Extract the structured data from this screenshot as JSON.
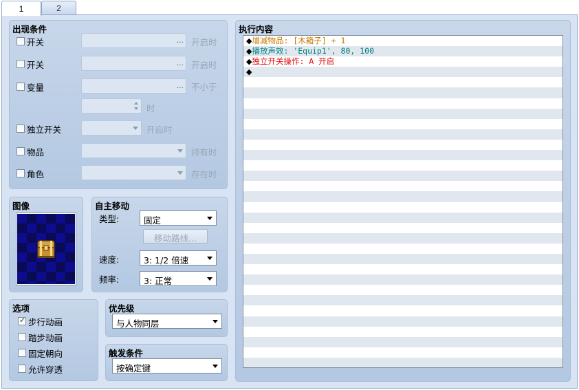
{
  "tabs": [
    {
      "label": "1"
    },
    {
      "label": "2"
    }
  ],
  "conditions": {
    "title": "出现条件",
    "switch1": {
      "label": "开关",
      "suffix": "开启时"
    },
    "switch2": {
      "label": "开关",
      "suffix": "开启时"
    },
    "variable": {
      "label": "变量",
      "suffix": "不小于",
      "suffix2": "时"
    },
    "self_switch": {
      "label": "独立开关",
      "suffix": "开启时"
    },
    "item": {
      "label": "物品",
      "suffix": "持有时"
    },
    "actor": {
      "label": "角色",
      "suffix": "存在时"
    },
    "dots": "..."
  },
  "image": {
    "title": "图像"
  },
  "autonomous": {
    "title": "自主移动",
    "type_label": "类型:",
    "type_value": "固定",
    "route_button": "移动路线...",
    "speed_label": "速度:",
    "speed_value": "3: 1/2 倍速",
    "freq_label": "频率:",
    "freq_value": "3: 正常"
  },
  "options": {
    "title": "选项",
    "items": [
      {
        "label": "步行动画",
        "checked": true
      },
      {
        "label": "踏步动画",
        "checked": false
      },
      {
        "label": "固定朝向",
        "checked": false
      },
      {
        "label": "允许穿透",
        "checked": false
      }
    ],
    "checkmark": "✓"
  },
  "priority": {
    "title": "优先级",
    "value": "与人物同层"
  },
  "trigger": {
    "title": "触发条件",
    "value": "按确定键"
  },
  "contents": {
    "title": "执行内容",
    "bullet": "◆",
    "commands": [
      {
        "text": "增减物品: [木箱子] + 1",
        "color": "#c87800"
      },
      {
        "text": "播放声效: 'Equip1', 80, 100",
        "color": "#008080"
      },
      {
        "text": "独立开关操作: A 开启",
        "color": "#e01010"
      },
      {
        "text": "",
        "color": "#000000"
      }
    ]
  },
  "colors": {
    "panel_bg": "#c0d2e8",
    "area_bg": "#d8e4f3"
  }
}
